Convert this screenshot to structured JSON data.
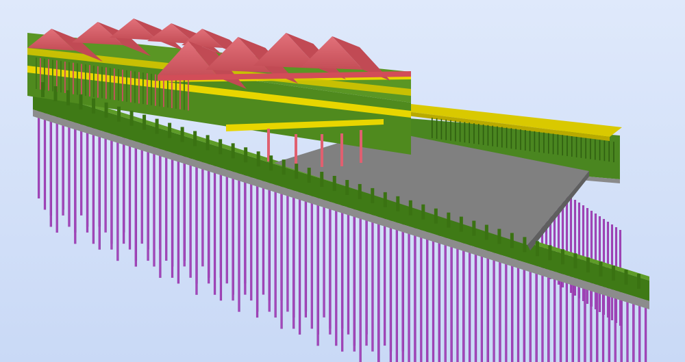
{
  "viewport": {
    "background_top": "#dfe9fb",
    "background_bottom": "#c9d9f6"
  },
  "model": {
    "element_types": [
      {
        "name": "roof",
        "color": "#d45a62"
      },
      {
        "name": "wall",
        "color": "#4f8a1e"
      },
      {
        "name": "slab-edge",
        "color": "#e6d400"
      },
      {
        "name": "column",
        "color": "#e06070"
      },
      {
        "name": "floor-slab",
        "color": "#7a7a7a"
      },
      {
        "name": "pile",
        "color": "#9a3bb0"
      },
      {
        "name": "beam",
        "color": "#8a8a8a"
      }
    ]
  }
}
